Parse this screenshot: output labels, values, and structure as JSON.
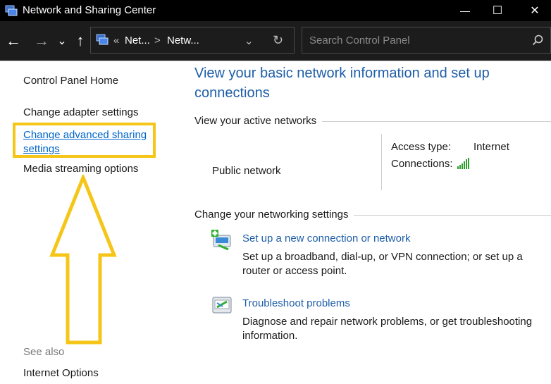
{
  "window": {
    "title": "Network and Sharing Center",
    "minimize_glyph": "—",
    "maximize_glyph": "☐",
    "close_glyph": "✕"
  },
  "nav": {
    "back_glyph": "←",
    "forward_glyph": "→",
    "recent_glyph": "⌄",
    "up_glyph": "↑",
    "breadcrumb_prefix": "«",
    "crumb1": "Net...",
    "crumb_sep": ">",
    "crumb2": "Netw...",
    "dropdown_glyph": "⌄",
    "refresh_glyph": "↻",
    "search_placeholder": "Search Control Panel"
  },
  "left_panel": {
    "home": "Control Panel Home",
    "adapter": "Change adapter settings",
    "advanced": "Change advanced sharing settings",
    "media": "Media streaming options",
    "see_also": "See also",
    "internet_options": "Internet Options"
  },
  "main": {
    "title": "View your basic network information and set up connections",
    "active_networks_label": "View your active networks",
    "network_name": "Public network",
    "access_type_label": "Access type:",
    "access_type_value": "Internet",
    "connections_label": "Connections:",
    "change_settings_label": "Change your networking settings",
    "tasks": [
      {
        "link": "Set up a new connection or network",
        "desc": "Set up a broadband, dial-up, or VPN connection; or set up a router or access point."
      },
      {
        "link": "Troubleshoot problems",
        "desc": "Diagnose and repair network problems, or get troubleshooting information."
      }
    ]
  },
  "colors": {
    "accent": "#1e5ea8",
    "highlight": "#f5c518",
    "signal": "#2f9e2f"
  },
  "icons": [
    "network-center-icon",
    "search-icon",
    "signal-bars-icon",
    "new-connection-icon",
    "troubleshoot-icon"
  ]
}
